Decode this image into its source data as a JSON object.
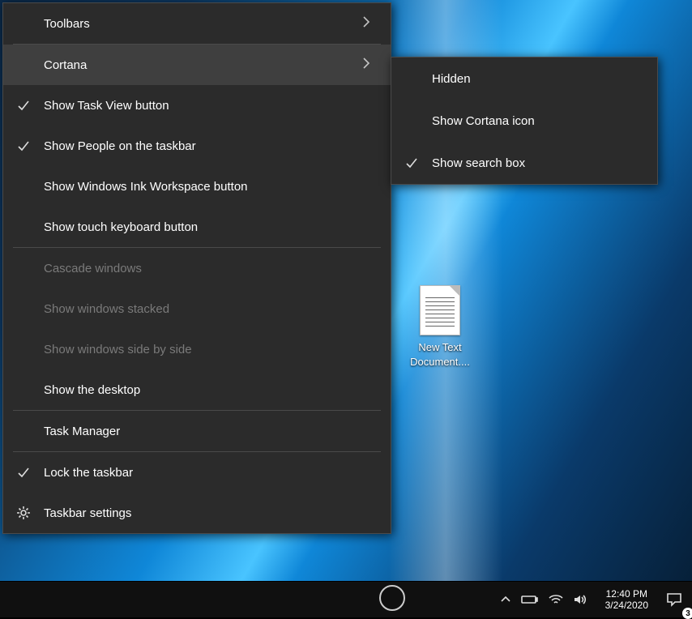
{
  "desktop": {
    "icon_label": "New Text Document...."
  },
  "main_menu": {
    "items": [
      {
        "label": "Toolbars",
        "submenu": true
      },
      null,
      {
        "label": "Cortana",
        "submenu": true,
        "hover": true
      },
      {
        "label": "Show Task View button",
        "checked": true
      },
      {
        "label": "Show People on the taskbar",
        "checked": true
      },
      {
        "label": "Show Windows Ink Workspace button"
      },
      {
        "label": "Show touch keyboard button"
      },
      null,
      {
        "label": "Cascade windows",
        "disabled": true
      },
      {
        "label": "Show windows stacked",
        "disabled": true
      },
      {
        "label": "Show windows side by side",
        "disabled": true
      },
      {
        "label": "Show the desktop"
      },
      null,
      {
        "label": "Task Manager"
      },
      null,
      {
        "label": "Lock the taskbar",
        "checked": true
      },
      {
        "label": "Taskbar settings",
        "icon": "gear"
      }
    ]
  },
  "sub_menu": {
    "items": [
      {
        "label": "Hidden"
      },
      {
        "label": "Show Cortana icon"
      },
      {
        "label": "Show search box",
        "checked": true
      }
    ]
  },
  "taskbar": {
    "time": "12:40 PM",
    "date": "3/24/2020",
    "action_center_badge": "3"
  }
}
